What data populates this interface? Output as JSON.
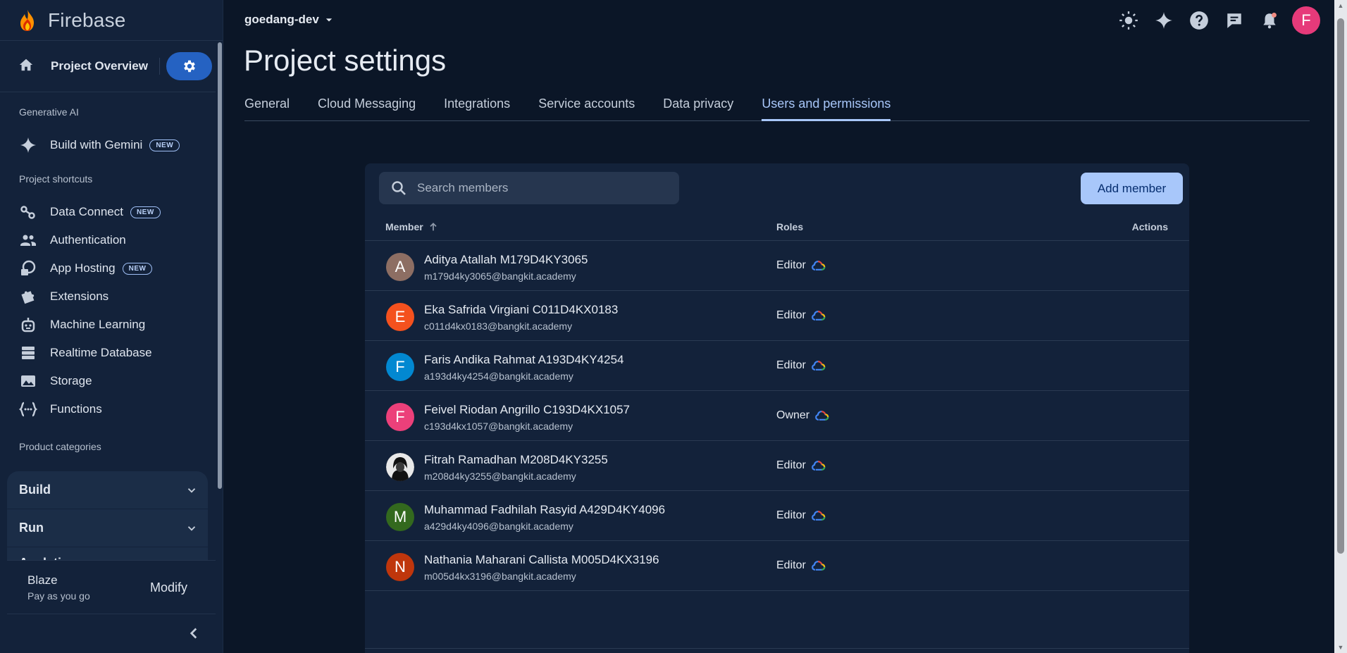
{
  "app": {
    "name": "Firebase"
  },
  "sidebar": {
    "overview_label": "Project Overview",
    "section_generative": "Generative AI",
    "gemini_label": "Build with Gemini",
    "section_shortcuts": "Project shortcuts",
    "items": [
      {
        "label": "Data Connect",
        "badge": "NEW",
        "icon": "data-connect-icon"
      },
      {
        "label": "Authentication",
        "badge": "",
        "icon": "people-icon"
      },
      {
        "label": "App Hosting",
        "badge": "NEW",
        "icon": "app-hosting-icon"
      },
      {
        "label": "Extensions",
        "badge": "",
        "icon": "puzzle-icon"
      },
      {
        "label": "Machine Learning",
        "badge": "",
        "icon": "robot-icon"
      },
      {
        "label": "Realtime Database",
        "badge": "",
        "icon": "database-icon"
      },
      {
        "label": "Storage",
        "badge": "",
        "icon": "image-icon"
      },
      {
        "label": "Functions",
        "badge": "",
        "icon": "functions-icon"
      }
    ],
    "new_badge": "NEW",
    "section_categories": "Product categories",
    "categories": [
      {
        "label": "Build"
      },
      {
        "label": "Run"
      },
      {
        "label": "Analytics"
      }
    ],
    "plan": {
      "name": "Blaze",
      "subtitle": "Pay as you go",
      "modify": "Modify"
    }
  },
  "header": {
    "project": "goedang-dev",
    "avatar_letter": "F"
  },
  "page": {
    "title": "Project settings",
    "tabs": [
      {
        "label": "General",
        "active": false
      },
      {
        "label": "Cloud Messaging",
        "active": false
      },
      {
        "label": "Integrations",
        "active": false
      },
      {
        "label": "Service accounts",
        "active": false
      },
      {
        "label": "Data privacy",
        "active": false
      },
      {
        "label": "Users and permissions",
        "active": true
      }
    ]
  },
  "members": {
    "search_placeholder": "Search members",
    "add_button": "Add member",
    "columns": {
      "member": "Member",
      "roles": "Roles",
      "actions": "Actions"
    },
    "rows": [
      {
        "initial": "A",
        "name": "Aditya Atallah M179D4KY3065",
        "email": "m179d4ky3065@bangkit.academy",
        "role": "Editor",
        "avatar_color": "#8d6e63"
      },
      {
        "initial": "E",
        "name": "Eka Safrida Virgiani C011D4KX0183",
        "email": "c011d4kx0183@bangkit.academy",
        "role": "Editor",
        "avatar_color": "#f4511e"
      },
      {
        "initial": "F",
        "name": "Faris Andika Rahmat A193D4KY4254",
        "email": "a193d4ky4254@bangkit.academy",
        "role": "Editor",
        "avatar_color": "#0288d1"
      },
      {
        "initial": "F",
        "name": "Feivel Riodan Angrillo C193D4KX1057",
        "email": "c193d4kx1057@bangkit.academy",
        "role": "Owner",
        "avatar_color": "#ec407a"
      },
      {
        "initial": "",
        "name": "Fitrah Ramadhan M208D4KY3255",
        "email": "m208d4ky3255@bangkit.academy",
        "role": "Editor",
        "avatar_color": "#1a1a1a"
      },
      {
        "initial": "M",
        "name": "Muhammad Fadhilah Rasyid A429D4KY4096",
        "email": "a429d4ky4096@bangkit.academy",
        "role": "Editor",
        "avatar_color": "#33691e"
      },
      {
        "initial": "N",
        "name": "Nathania Maharani Callista M005D4KX3196",
        "email": "m005d4kx3196@bangkit.academy",
        "role": "Editor",
        "avatar_color": "#bf360c"
      }
    ]
  },
  "colors": {
    "accent": "#a8c7fa",
    "primary_button": "#2562c2",
    "background": "#0b1627"
  }
}
